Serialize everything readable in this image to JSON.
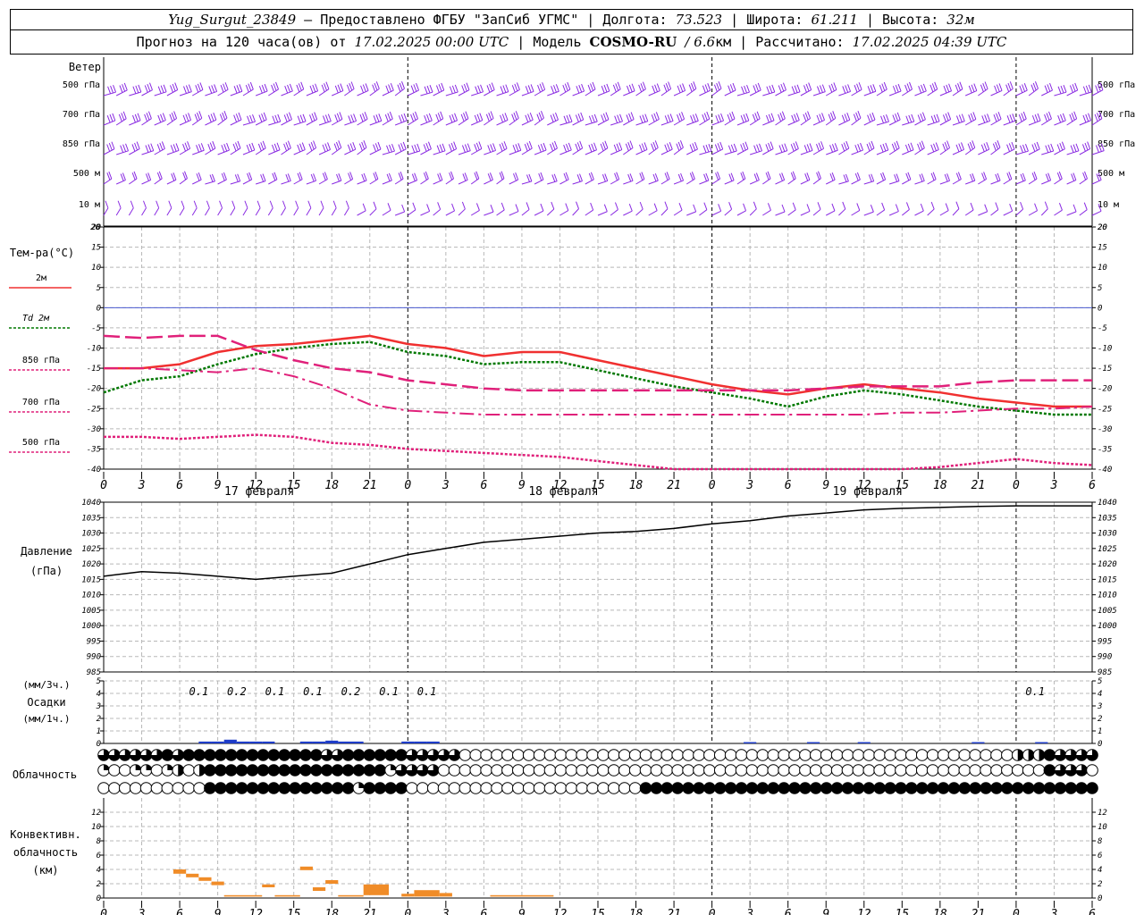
{
  "header": {
    "station": "Yug_Surgut_23849",
    "provider": "Предоставлено ФГБУ \"ЗапСиб УГМС\"",
    "lon_label": "Долгота:",
    "lon_value": "73.523",
    "lat_label": "Широта:",
    "lat_value": "61.211",
    "alt_label": "Высота:",
    "alt_value": "32м",
    "forecast_label": "Прогноз на 120 часа(ов) от",
    "forecast_start": "17.02.2025 00:00 UTC",
    "model_label": "Модель",
    "model_name": "COSMO-RU",
    "model_res": "/ 6.6",
    "model_res_unit": "км",
    "calc_label": "Рассчитано:",
    "calc_time": "17.02.2025 04:39 UTC"
  },
  "colors": {
    "t2m": "#f03030",
    "td2m": "#007800",
    "t850": "#e0207a",
    "t700": "#e0207a",
    "t500": "#e0207a",
    "wind": "#8a2be2",
    "pressure": "#000000",
    "precip": "#1e3cc8",
    "convective": "#f08c28",
    "zero_line": "#4a5ad0"
  },
  "chart_data": [
    {
      "type": "wind_barbs",
      "title": "Ветер",
      "levels": [
        "500 гПа",
        "700 гПа",
        "850 гПа",
        "500 м",
        "10 м"
      ],
      "y_tick_top": "20"
    },
    {
      "type": "line",
      "ylabel": "Тем-ра(°C)",
      "ylim": [
        -40,
        20
      ],
      "yticks": [
        "20",
        "15",
        "10",
        "5",
        "0",
        "-5",
        "-10",
        "-15",
        "-20",
        "-25",
        "-30",
        "-35",
        "-40"
      ],
      "xticks": [
        "0",
        "3",
        "6",
        "9",
        "12",
        "15",
        "18",
        "21",
        "0",
        "3",
        "6",
        "9",
        "12",
        "15",
        "18",
        "21",
        "0",
        "3",
        "6",
        "9",
        "12",
        "15",
        "18",
        "21",
        "0",
        "3",
        "6"
      ],
      "day_labels": [
        "17 февраля",
        "18 февраля",
        "19 февраля"
      ],
      "x_hours": [
        0,
        3,
        6,
        9,
        12,
        15,
        18,
        21,
        24,
        27,
        30,
        33,
        36,
        39,
        42,
        45,
        48,
        51,
        54,
        57,
        60,
        63,
        66,
        69,
        72,
        75,
        78
      ],
      "series": [
        {
          "name": "2м",
          "key": "t2m",
          "dash": "",
          "width": 2.5,
          "values": [
            -15,
            -15,
            -14,
            -11,
            -9.5,
            -9,
            -8,
            -7,
            -9,
            -10,
            -12,
            -11,
            -11,
            -13,
            -15,
            -17,
            -19,
            -20.5,
            -21.5,
            -20,
            -19,
            -20,
            -21,
            -22.5,
            -23.5,
            -24.5,
            -24.5
          ]
        },
        {
          "name": "Td 2м",
          "key": "td2m",
          "dash": "3,2",
          "width": 2.5,
          "values": [
            -21,
            -18,
            -17,
            -14,
            -11.5,
            -10,
            -9,
            -8.5,
            -11,
            -12,
            -14,
            -13.5,
            -13.5,
            -15.5,
            -17.5,
            -19.5,
            -21,
            -22.5,
            -24.5,
            -22,
            -20.5,
            -21.5,
            -23,
            -24.5,
            -25.5,
            -26.5,
            -26.5
          ]
        },
        {
          "name": "850 гПа",
          "key": "t850",
          "dash": "18,6",
          "width": 2.5,
          "values": [
            -7,
            -7.5,
            -7,
            -7,
            -10.5,
            -13,
            -15,
            -16,
            -18,
            -19,
            -20,
            -20.5,
            -20.5,
            -20.5,
            -20.5,
            -20.5,
            -20.5,
            -20.5,
            -20.5,
            -20,
            -19.5,
            -19.5,
            -19.5,
            -18.5,
            -18,
            -18,
            -18
          ]
        },
        {
          "name": "700 гПа",
          "key": "t700",
          "dash": "16,5,3,5",
          "width": 2,
          "values": [
            -15,
            -15,
            -15.5,
            -16,
            -15,
            -17,
            -20,
            -24,
            -25.5,
            -26,
            -26.5,
            -26.5,
            -26.5,
            -26.5,
            -26.5,
            -26.5,
            -26.5,
            -26.5,
            -26.5,
            -26.5,
            -26.5,
            -26,
            -26,
            -25.5,
            -25,
            -25,
            -24.5
          ]
        },
        {
          "name": "500 гПа",
          "key": "t500",
          "dash": "3,2",
          "width": 2.5,
          "values": [
            -32,
            -32,
            -32.5,
            -32,
            -31.5,
            -32,
            -33.5,
            -34,
            -35,
            -35.5,
            -36,
            -36.5,
            -37,
            -38,
            -39,
            -40,
            -41,
            -41,
            -41,
            -41,
            -41,
            -40,
            -39.5,
            -38.5,
            -37.5,
            -38.5,
            -39
          ]
        }
      ]
    },
    {
      "type": "line",
      "title": "Давление",
      "ylabel": "(гПа)",
      "ylim": [
        985,
        1040
      ],
      "yticks": [
        "1040",
        "1035",
        "1030",
        "1025",
        "1020",
        "1015",
        "1010",
        "1005",
        "1000",
        "995",
        "990",
        "985"
      ],
      "x_hours": [
        0,
        3,
        6,
        9,
        12,
        15,
        18,
        21,
        24,
        27,
        30,
        33,
        36,
        39,
        42,
        45,
        48,
        51,
        54,
        57,
        60,
        63,
        66,
        69,
        72,
        75,
        78
      ],
      "series": [
        {
          "name": "Давление",
          "values": [
            1016,
            1017.5,
            1017,
            1016,
            1015,
            1016,
            1017,
            1020,
            1023,
            1025,
            1027,
            1028,
            1029,
            1030,
            1030.5,
            1031.5,
            1033,
            1034,
            1035.5,
            1036.5,
            1037.5,
            1038,
            1038.3,
            1038.6,
            1038.8,
            1038.8,
            1038.8
          ]
        }
      ]
    },
    {
      "type": "bar",
      "title": "Осадки",
      "ylabel_top": "(мм/3ч.)",
      "ylabel_bottom": "(мм/1ч.)",
      "ylim": [
        0,
        5
      ],
      "yticks": [
        "5",
        "4",
        "3",
        "2",
        "1",
        "0"
      ],
      "labels_3h": [
        {
          "hour": 7.5,
          "text": "0.1"
        },
        {
          "hour": 10.5,
          "text": "0.2"
        },
        {
          "hour": 13.5,
          "text": "0.1"
        },
        {
          "hour": 16.5,
          "text": "0.1"
        },
        {
          "hour": 19.5,
          "text": "0.2"
        },
        {
          "hour": 22.5,
          "text": "0.1"
        },
        {
          "hour": 25.5,
          "text": "0.1"
        },
        {
          "hour": 73.5,
          "text": "0.1"
        }
      ],
      "bars_1h": [
        {
          "hour": 8,
          "value": 0.1
        },
        {
          "hour": 9,
          "value": 0.1
        },
        {
          "hour": 10,
          "value": 0.2
        },
        {
          "hour": 11,
          "value": 0.1
        },
        {
          "hour": 12,
          "value": 0.1
        },
        {
          "hour": 13,
          "value": 0.1
        },
        {
          "hour": 16,
          "value": 0.1
        },
        {
          "hour": 17,
          "value": 0.1
        },
        {
          "hour": 18,
          "value": 0.15
        },
        {
          "hour": 19,
          "value": 0.1
        },
        {
          "hour": 20,
          "value": 0.1
        },
        {
          "hour": 24,
          "value": 0.1
        },
        {
          "hour": 25,
          "value": 0.1
        },
        {
          "hour": 26,
          "value": 0.1
        },
        {
          "hour": 51,
          "value": 0.05
        },
        {
          "hour": 56,
          "value": 0.05
        },
        {
          "hour": 60,
          "value": 0.05
        },
        {
          "hour": 69,
          "value": 0.05
        },
        {
          "hour": 74,
          "value": 0.05
        }
      ]
    },
    {
      "type": "cloud_symbols",
      "title": "Облачность",
      "rows": [
        "3333334344444444444443344444433333000000000000000000000000000000000000000000000000000022243333",
        "1001101202444444444444444441333300000000000000000000000000000000000000000000000000000000043330",
        "0000000000444444444444441444400000000000000000000004444444444444444444444444444444444444444444"
      ]
    },
    {
      "type": "bar",
      "title": "Конвективн. облачность",
      "ylabel": "(км)",
      "ylim": [
        0,
        14
      ],
      "yticks": [
        "12",
        "10",
        "8",
        "6",
        "4",
        "2",
        "0"
      ],
      "bars": [
        {
          "h0": 5.5,
          "h1": 6.5,
          "base": 3.4,
          "top": 4.0
        },
        {
          "h0": 6.5,
          "h1": 7.5,
          "base": 2.9,
          "top": 3.4
        },
        {
          "h0": 7.5,
          "h1": 8.5,
          "base": 2.4,
          "top": 2.9
        },
        {
          "h0": 8.5,
          "h1": 9.5,
          "base": 1.8,
          "top": 2.3
        },
        {
          "h0": 9.5,
          "h1": 12.5,
          "base": 0.2,
          "top": 0.4
        },
        {
          "h0": 12.5,
          "h1": 13.5,
          "base": 1.5,
          "top": 1.9
        },
        {
          "h0": 13.5,
          "h1": 15.5,
          "base": 0.2,
          "top": 0.4
        },
        {
          "h0": 15.5,
          "h1": 16.5,
          "base": 3.9,
          "top": 4.4
        },
        {
          "h0": 16.5,
          "h1": 17.5,
          "base": 1.0,
          "top": 1.5
        },
        {
          "h0": 17.5,
          "h1": 18.5,
          "base": 2.0,
          "top": 2.5
        },
        {
          "h0": 18.5,
          "h1": 20.5,
          "base": 0.2,
          "top": 0.4
        },
        {
          "h0": 20.5,
          "h1": 22.5,
          "base": 0.4,
          "top": 1.9
        },
        {
          "h0": 23.5,
          "h1": 24.5,
          "base": 0.2,
          "top": 0.6
        },
        {
          "h0": 24.5,
          "h1": 26.5,
          "base": 0.2,
          "top": 1.1
        },
        {
          "h0": 26.5,
          "h1": 27.5,
          "base": 0.2,
          "top": 0.7
        },
        {
          "h0": 30.5,
          "h1": 35.5,
          "base": 0.2,
          "top": 0.4
        }
      ]
    }
  ]
}
